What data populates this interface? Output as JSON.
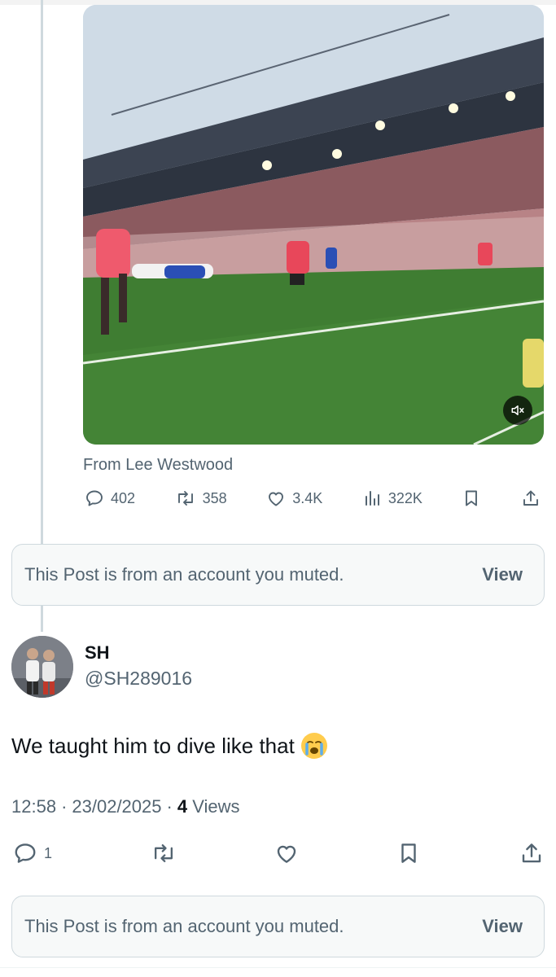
{
  "quoted_post": {
    "from_label": "From Lee Westwood",
    "stats": {
      "replies": "402",
      "reposts": "358",
      "likes": "3.4K",
      "views": "322K"
    }
  },
  "muted_notice": {
    "text": "This Post is from an account you muted.",
    "action": "View"
  },
  "reply_post": {
    "display_name": "SH",
    "handle": "@SH289016",
    "text": "We taught him to dive like that",
    "time": "12:58",
    "date": "23/02/2025",
    "views_count": "4",
    "views_label": "Views",
    "stats": {
      "replies": "1"
    }
  },
  "muted_notice_2": {
    "text": "This Post is from an account you muted.",
    "action": "View"
  },
  "colors": {
    "secondary_text": "#536471",
    "primary_text": "#0f1419",
    "border": "#cfd9de",
    "pitch_green": "#3f7d32",
    "kit_red": "#e8475a"
  }
}
